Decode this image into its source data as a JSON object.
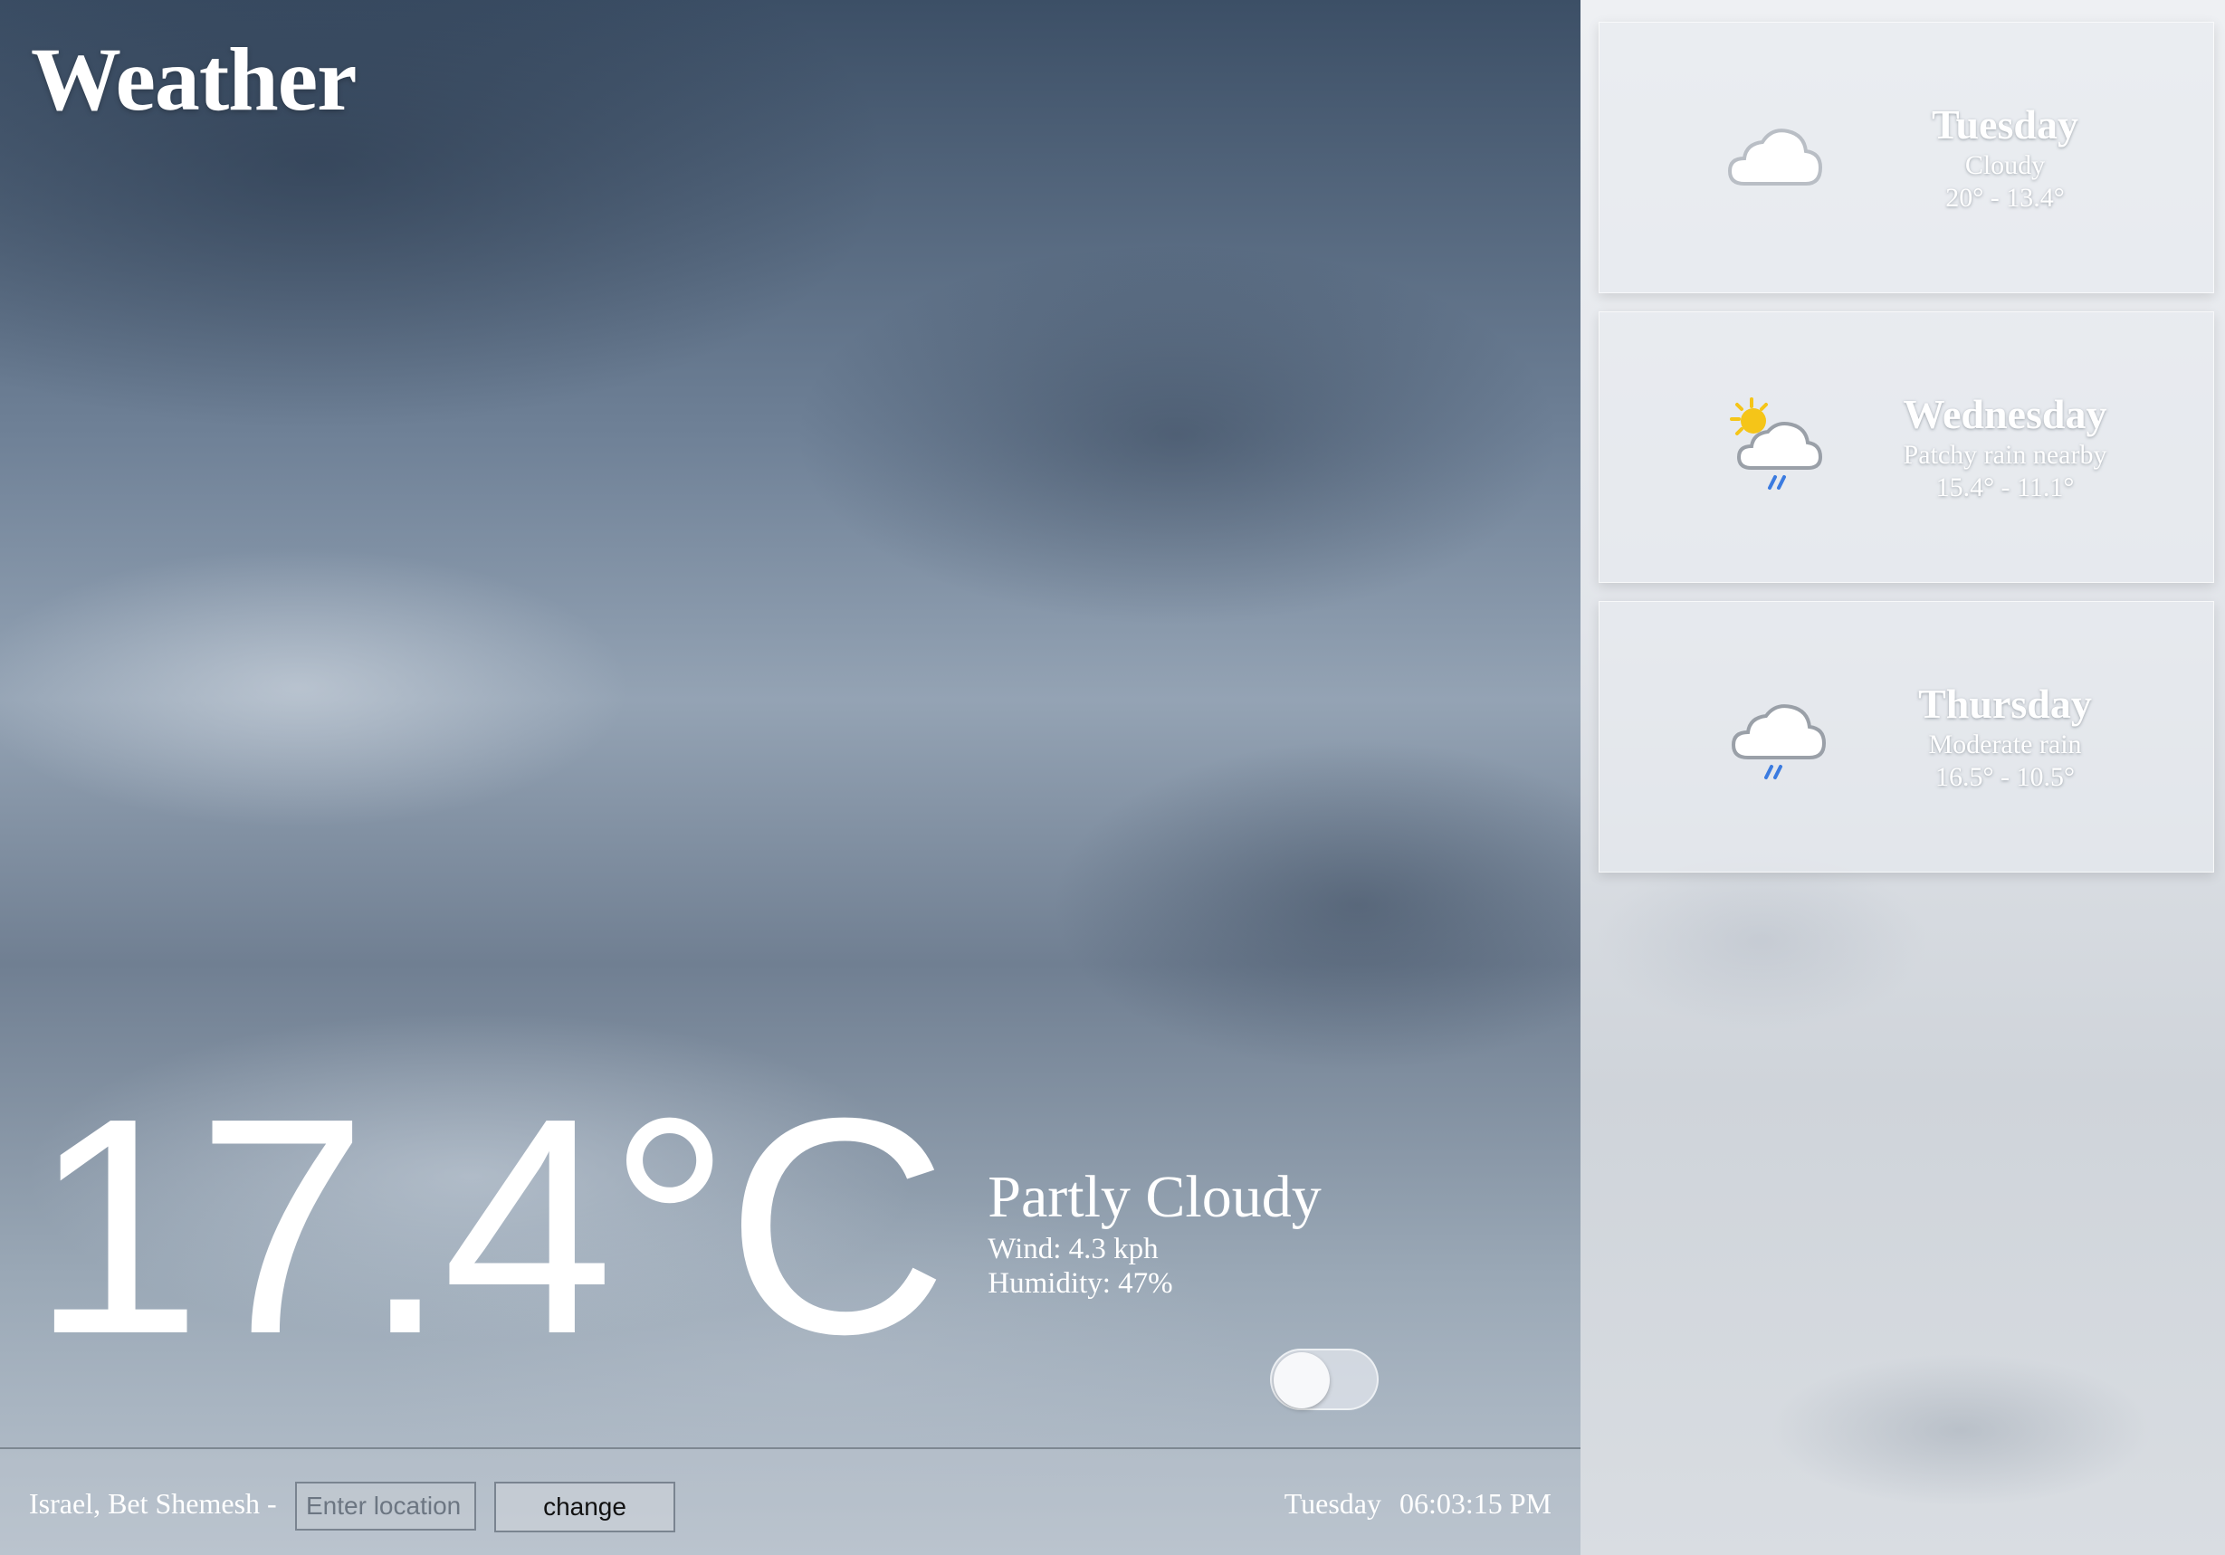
{
  "app": {
    "title": "Weather"
  },
  "current": {
    "temperature": "17.4°C",
    "condition": "Partly Cloudy",
    "wind": "Wind: 4.3 kph",
    "humidity": "Humidity: 47%"
  },
  "unit_toggle": {
    "state": "off"
  },
  "bottom_bar": {
    "location": "Israel, Bet Shemesh -",
    "location_placeholder": "Enter location",
    "change_label": "change",
    "day": "Tuesday",
    "time": "06:03:15 PM"
  },
  "forecast": [
    {
      "day": "Tuesday",
      "condition": "Cloudy",
      "range": "20°  -  13.4°",
      "icon": "cloud-icon"
    },
    {
      "day": "Wednesday",
      "condition": "Patchy rain nearby",
      "range": "15.4°  -  11.1°",
      "icon": "sun-cloud-rain-icon"
    },
    {
      "day": "Thursday",
      "condition": "Moderate rain",
      "range": "16.5°  -  10.5°",
      "icon": "cloud-rain-icon"
    }
  ],
  "colors": {
    "rain_drop": "#3b7be0",
    "sun": "#f5c518"
  }
}
